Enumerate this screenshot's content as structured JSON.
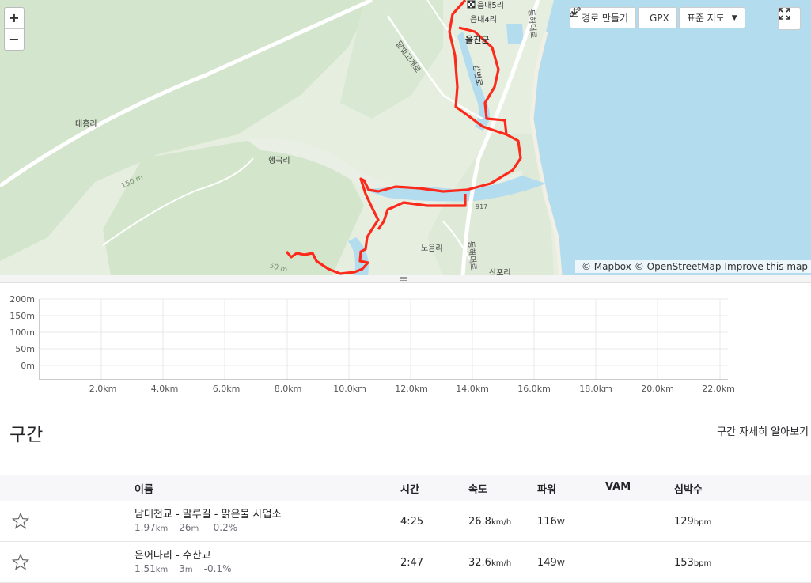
{
  "map": {
    "zoom_in": "+",
    "zoom_out": "−",
    "labels": {
      "daeheung": "대흥리",
      "haenggok": "행곡리",
      "noeum": "노음리",
      "eupnae5": "읍내5리",
      "eupnae4": "읍내4리",
      "uljin": "울진군",
      "gangbyeon": "강변로",
      "donghae_top": "동해대로",
      "donghae_bottom": "동해대로",
      "dalbit": "달빛고개로",
      "contour150": "150 m",
      "contour50": "50 m",
      "sanpo": "산포리",
      "route917": "917"
    },
    "toolbar": {
      "create_route": "경로 만들기",
      "gpx": "GPX",
      "map_type": "표준 지도"
    },
    "attribution": {
      "mapbox": "© Mapbox",
      "osm": "© OpenStreetMap",
      "improve": "Improve this map"
    },
    "colors": {
      "route": "#fc2a1b",
      "sea": "#b3dcef",
      "land": "#e8efe3"
    }
  },
  "elevation": {
    "y_labels": [
      "200m",
      "150m",
      "100m",
      "50m",
      "0m"
    ],
    "x_labels": [
      "2.0km",
      "4.0km",
      "6.0km",
      "8.0km",
      "10.0km",
      "12.0km",
      "14.0km",
      "16.0km",
      "18.0km",
      "20.0km",
      "22.0km"
    ]
  },
  "segments": {
    "title": "구간",
    "learn_more": "구간 자세히 알아보기",
    "headers": {
      "name": "이름",
      "time": "시간",
      "speed": "속도",
      "power": "파워",
      "vam": "VAM",
      "hr": "심박수"
    },
    "rows": [
      {
        "name": "남대천교 - 말루길 - 맑은물 사업소",
        "distance": "1.97",
        "distance_unit": "km",
        "elev": "26",
        "elev_unit": "m",
        "grade": "-0.2%",
        "time": "4:25",
        "speed": "26.8",
        "speed_unit": "km/h",
        "power": "116",
        "power_unit": "W",
        "vam": "",
        "hr": "129",
        "hr_unit": "bpm"
      },
      {
        "name": "은어다리 - 수산교",
        "distance": "1.51",
        "distance_unit": "km",
        "elev": "3",
        "elev_unit": "m",
        "grade": "-0.1%",
        "time": "2:47",
        "speed": "32.6",
        "speed_unit": "km/h",
        "power": "149",
        "power_unit": "W",
        "vam": "",
        "hr": "153",
        "hr_unit": "bpm"
      }
    ]
  }
}
